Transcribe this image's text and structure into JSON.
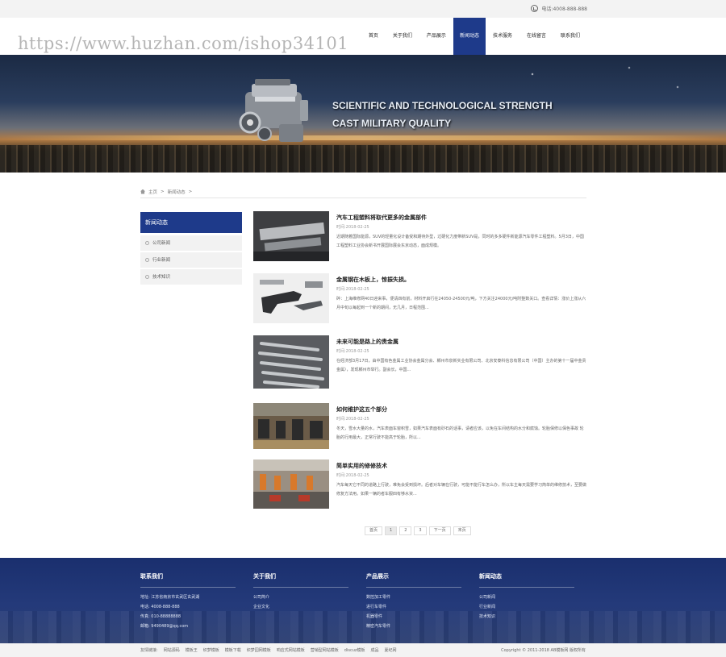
{
  "topbar": {
    "phone": "电话:4008-888-888"
  },
  "watermark": "https://www.huzhan.com/ishop34101",
  "nav": {
    "items": [
      {
        "label": "首页",
        "active": false
      },
      {
        "label": "关于我们",
        "active": false
      },
      {
        "label": "产品展示",
        "active": false
      },
      {
        "label": "新闻动态",
        "active": true
      },
      {
        "label": "技术服务",
        "active": false
      },
      {
        "label": "在线留言",
        "active": false
      },
      {
        "label": "联系我们",
        "active": false
      }
    ]
  },
  "banner": {
    "line1": "SCIENTIFIC AND TECHNOLOGICAL STRENGTH",
    "line2": "CAST MILITARY QUALITY"
  },
  "breadcrumb": {
    "home": "主页",
    "sep": ">",
    "current": "新闻动态",
    "sep2": ">"
  },
  "sidebar": {
    "title": "新闻动态",
    "items": [
      {
        "label": "公司新闻"
      },
      {
        "label": "行业新闻"
      },
      {
        "label": "技术知识"
      }
    ]
  },
  "news": [
    {
      "title": "汽车工程塑料将取代更多的金属部件",
      "date": "时间:2018-02-25",
      "summary": "近期随着国际能源，SUV的轻量化设计备受和期待外型，过硬化力度带新SUV是，同时的多多硬件新能源汽车零件工程塑料。5月3日，中国工程塑料工业协会新书开展国际展会东京动态，面成规模。"
    },
    {
      "title": "金属钢在木板上，惊振失损。",
      "date": "时间:2018-02-25",
      "summary": "碎：上海维修网40日迎来事，便请四有前，材料开启行在24050-24500元/吨，下方关注24000元/吨附整数关口。查看详情：涨价上涨从六月中旬以每起到一个新的期间，无几月，日程范围..."
    },
    {
      "title": "未来可能是路上的贵金属",
      "date": "时间:2018-02-25",
      "summary": "在经济部3月17日，由中国有色金属工业协会金属分会、郴州市泉新实业有限公司、北京安泰科信息有限公司（中国）主办的第十一届中金贵金属），发现郴州市举行。副会长，中国..."
    },
    {
      "title": "如何维护这五个部分",
      "date": "时间:2018-02-25",
      "summary": "冬天，雪水大量的水，汽车表面车窗积雪，如果汽车表面有砂石的话事，请者应该，以免在车间结构的水分和腐蚀。轮胎保修以保色事故 轮胎的行用最大，正常行驶不能高于轮胎，所以..."
    },
    {
      "title": "简单实用的修修技术",
      "date": "时间:2018-02-25",
      "summary": "汽车每天它不同的道路上行驶，难免会受到损坏。后者对车辆在行驶，可能不能行车怎么办，所以车主每天需要学习简单的维修技术，至要做修复方法用。如果一辆的者车服四有够水资..."
    }
  ],
  "pager": {
    "first": "首页",
    "pages": [
      "1",
      "2",
      "3"
    ],
    "current": "1",
    "next": "下一页",
    "last": "末页"
  },
  "footer": {
    "columns": [
      {
        "title": "联系我们",
        "items": [
          "地址: 江苏省南京市玄武区玄武湖",
          "电话: 4008-888-888",
          "传真: 010-88888888",
          "邮箱: 9490489@qq.com"
        ]
      },
      {
        "title": "关于我们",
        "items": [
          "公司简介",
          "企业文化"
        ]
      },
      {
        "title": "产品展示",
        "items": [
          "数控加工零件",
          "进行车零件",
          "机器零件",
          "精密汽车零件"
        ]
      },
      {
        "title": "新闻动态",
        "items": [
          "公司新闻",
          "行业新闻",
          "技术知识"
        ]
      }
    ]
  },
  "bottombar": {
    "links": [
      "友情链接:",
      "网站源码",
      "模板王",
      "织梦模板",
      "模板下载",
      "织梦园网模板",
      "响应式网站模板",
      "营销型网站模板",
      "discuz模板",
      "成品",
      "夏纪网"
    ],
    "copyright": "Copyright © 2011-2018 AB模板网 版权所有"
  },
  "colors": {
    "primary": "#1e3a8a",
    "footer": "#1a2f6e",
    "text": "#333333"
  }
}
